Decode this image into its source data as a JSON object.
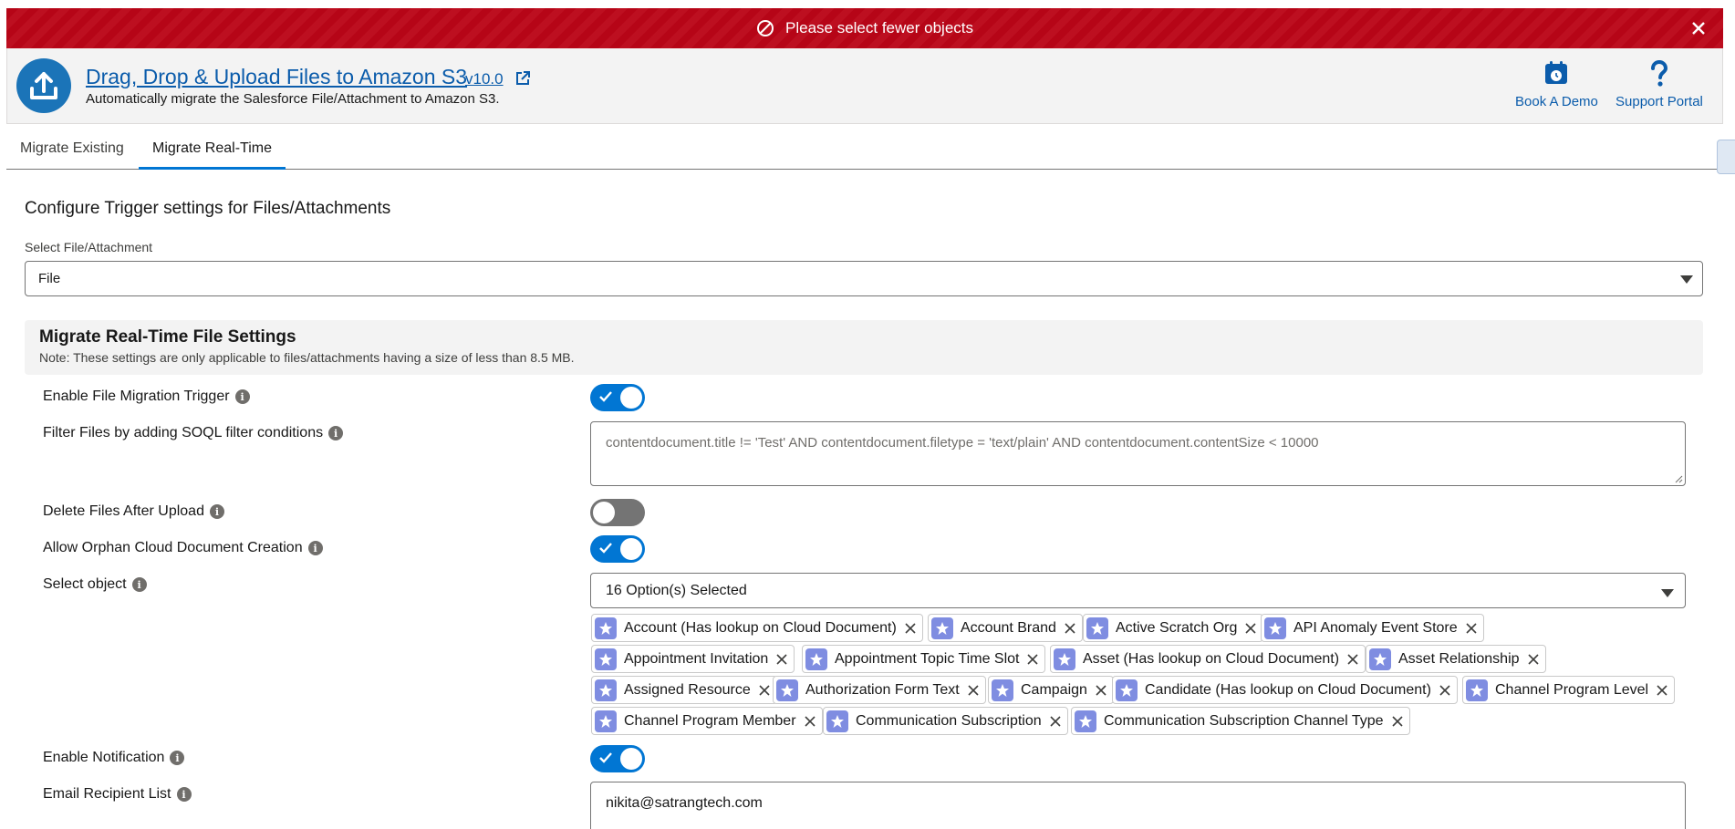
{
  "banner": {
    "message": "Please select fewer objects",
    "color": "#ba0517"
  },
  "header": {
    "title": "Drag, Drop & Upload Files to Amazon S3",
    "version": "v10.0",
    "subtitle": "Automatically migrate the Salesforce File/Attachment to Amazon S3.",
    "links": [
      {
        "label": "Book A Demo",
        "icon": "calendar-icon"
      },
      {
        "label": "Support Portal",
        "icon": "question-icon"
      }
    ]
  },
  "tabs": [
    {
      "label": "Migrate Existing",
      "active": false
    },
    {
      "label": "Migrate Real-Time",
      "active": true
    }
  ],
  "config": {
    "title": "Configure Trigger settings for Files/Attachments",
    "select_label": "Select File/Attachment",
    "select_value": "File"
  },
  "settings": {
    "title": "Migrate Real-Time File Settings",
    "note": "Note: These settings are only applicable to files/attachments having a size of less than 8.5 MB."
  },
  "rows": {
    "enable_trigger": {
      "label": "Enable File Migration Trigger",
      "on": true
    },
    "filter": {
      "label": "Filter Files by adding SOQL filter conditions",
      "placeholder": "contentdocument.title != 'Test' AND contentdocument.filetype = 'text/plain' AND contentdocument.contentSize < 10000"
    },
    "delete_after": {
      "label": "Delete Files After Upload",
      "on": false
    },
    "orphan": {
      "label": "Allow Orphan Cloud Document Creation",
      "on": true
    },
    "select_object": {
      "label": "Select object",
      "summary": "16 Option(s) Selected",
      "pills": [
        "Account (Has lookup on Cloud Document)",
        "Account Brand",
        "Active Scratch Org",
        "API Anomaly Event Store",
        "Appointment Invitation",
        "Appointment Topic Time Slot",
        "Asset (Has lookup on Cloud Document)",
        "Asset Relationship",
        "Assigned Resource",
        "Authorization Form Text",
        "Campaign",
        "Candidate (Has lookup on Cloud Document)",
        "Channel Program Level",
        "Channel Program Member",
        "Communication Subscription",
        "Communication Subscription Channel Type"
      ]
    },
    "notification": {
      "label": "Enable Notification",
      "on": true
    },
    "email": {
      "label": "Email Recipient List",
      "value": "nikita@satrangtech.com"
    }
  },
  "colors": {
    "brand": "#0176d3",
    "link": "#0b5cab",
    "pill_icon": "#7f8de1"
  }
}
